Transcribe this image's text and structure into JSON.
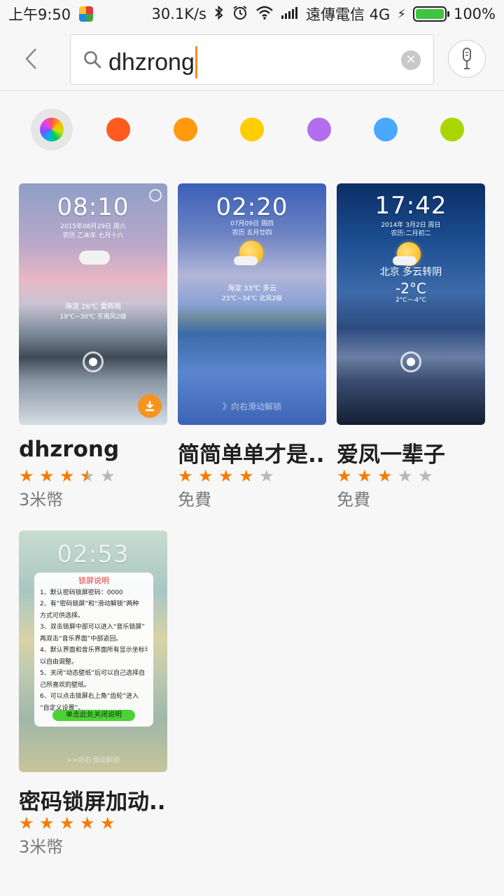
{
  "status_bar": {
    "time": "上午9:50",
    "speed": "30.1K/s",
    "carrier": "遠傳電信 4G",
    "battery": "100%",
    "battery_level": 1.0
  },
  "header": {
    "search_query": "dhzrong"
  },
  "color_filters": [
    {
      "name": "all",
      "color": "multicolor",
      "selected": true
    },
    {
      "name": "red",
      "color": "#ff5a1f"
    },
    {
      "name": "orange",
      "color": "#ff9a0f"
    },
    {
      "name": "yellow",
      "color": "#ffcd00"
    },
    {
      "name": "purple",
      "color": "#b36ef0"
    },
    {
      "name": "blue",
      "color": "#4aa9ff"
    },
    {
      "name": "green",
      "color": "#a9d600"
    }
  ],
  "items": [
    {
      "title": "dhzrong",
      "rating": 3.5,
      "price": "3米幣",
      "preview": {
        "clock": "08:10",
        "date": "2015年08月29日 周六",
        "lunar": "农历 乙未年 七月十六",
        "weather": "海淀  26℃  雷阵雨",
        "weather2": "19℃~30℃  东南风2级"
      }
    },
    {
      "title": "简简单单才是...",
      "rating": 4,
      "price": "免費",
      "preview": {
        "clock": "02:20",
        "date": "07月09日 周四",
        "lunar": "农历 五月廿四",
        "weather": "海淀  33℃  多云",
        "weather2": "23℃~34℃  北风2级",
        "unlock": "》向右滑动解锁"
      }
    },
    {
      "title": "爱凤一辈子",
      "rating": 3,
      "price": "免費",
      "preview": {
        "clock": "17:42",
        "date": "2014年 3月2日 周日",
        "lunar": "农历:二月初二",
        "city": "北京  多云转阴",
        "temp": "-2°C",
        "range": "2°C~-4°C"
      }
    },
    {
      "title": "密码锁屏加动...",
      "rating": 5,
      "price": "3米幣",
      "preview": {
        "clock": "02:53",
        "panel_title": "锁屏说明",
        "lines": [
          "1、默认密码锁屏密码：0000",
          "2、有“密码锁屏”和“滑动解锁”两种",
          "方式可供选择。",
          "3、双击锁屏中部可以进入“音乐锁屏”",
          "再双击“音乐界面”中部返回。",
          "4、默认界面和音乐界面所有显示坐标可",
          "以自由调整。",
          "5、关闭“动态壁纸”后可以自己选择自",
          "己所喜欢的壁纸。",
          "6、可以点击锁屏右上角“齿轮”进入",
          "“自定义设置”。"
        ],
        "close_label": "单击此处关闭说明",
        "unlock": ">>向右滑动解锁"
      }
    }
  ]
}
